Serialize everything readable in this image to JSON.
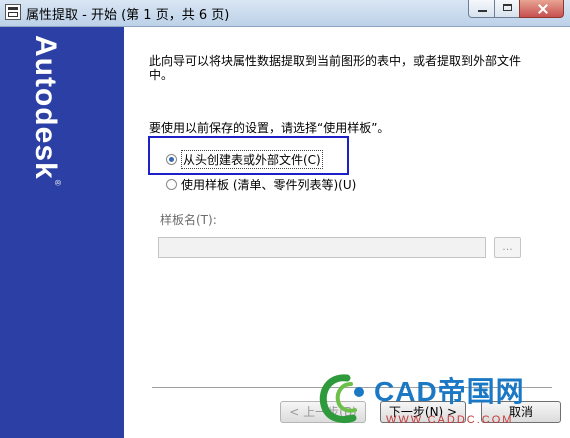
{
  "window": {
    "title": "属性提取 - 开始 (第 1 页，共 6 页)"
  },
  "banner": {
    "logo_text": "Autodesk",
    "logo_mark": "®"
  },
  "content": {
    "description": "此向导可以将块属性数据提取到当前图形的表中，或者提取到外部文件中。",
    "prompt": "要使用以前保存的设置，请选择“使用样板”。",
    "options": [
      {
        "label": "从头创建表或外部文件(C)",
        "checked": true
      },
      {
        "label": "使用样板 (清单、零件列表等)(U)",
        "checked": false
      }
    ],
    "template_label": "样板名(T):",
    "template_value": "",
    "browse_label": "..."
  },
  "buttons": {
    "back": "< 上一步(B)",
    "next": "下一步(N) >",
    "cancel": "取消"
  },
  "watermark": {
    "brand": "CAD帝国网",
    "url": "WWW.CADDC.COM"
  },
  "colors": {
    "banner": "#2b3fa4",
    "highlight_box": "#1d1fc8",
    "watermark_blue": "#1a78c4"
  }
}
